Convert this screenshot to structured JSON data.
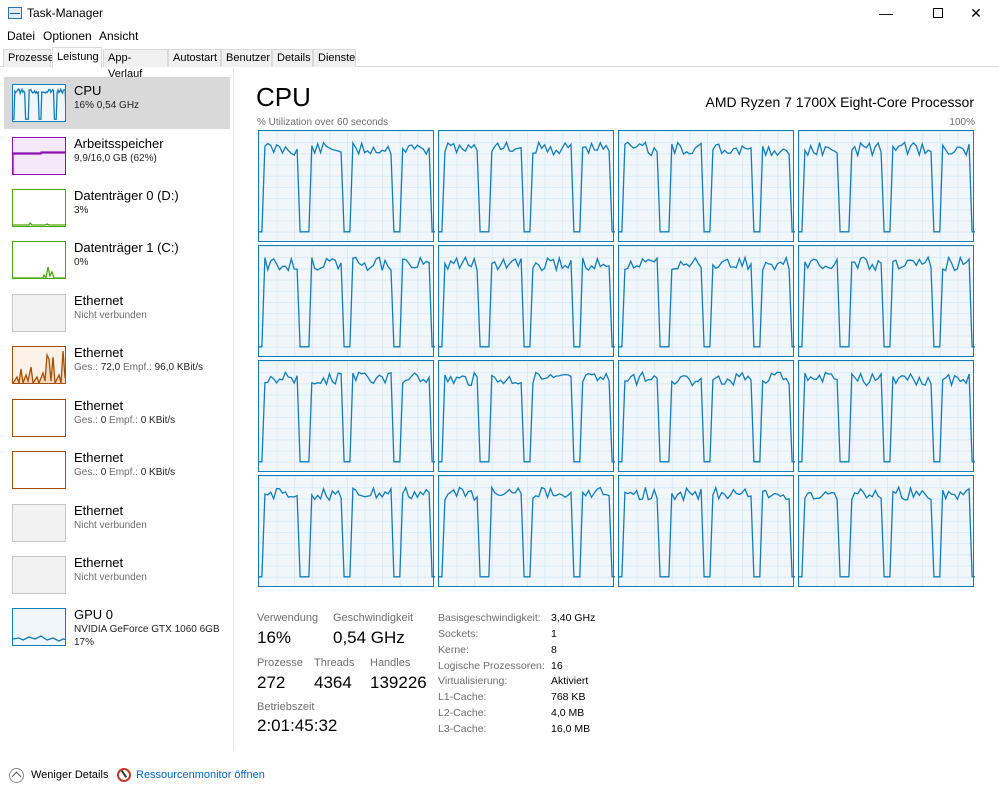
{
  "window": {
    "title": "Task-Manager"
  },
  "menu": [
    "Datei",
    "Optionen",
    "Ansicht"
  ],
  "tabs": [
    "Prozesse",
    "Leistung",
    "App-Verlauf",
    "Autostart",
    "Benutzer",
    "Details",
    "Dienste"
  ],
  "active_tab": "Leistung",
  "sidebar": {
    "items": [
      {
        "title": "CPU",
        "sub": "16% 0,54 GHz",
        "color": "#117dbb",
        "kind": "cpu",
        "selected": true
      },
      {
        "title": "Arbeitsspeicher",
        "sub": "9,9/16,0 GB (62%)",
        "color": "#8b12ae",
        "kind": "memory"
      },
      {
        "title": "Datenträger 0 (D:)",
        "sub": "3%",
        "color": "#4da60c",
        "kind": "disk0"
      },
      {
        "title": "Datenträger 1 (C:)",
        "sub": "0%",
        "color": "#4da60c",
        "kind": "disk1"
      },
      {
        "title": "Ethernet",
        "sub": "Nicht verbunden",
        "color": "#c8c8c8",
        "kind": "none",
        "gray": true
      },
      {
        "title": "Ethernet",
        "sub_prefix1": "Ges.:",
        "sub_value1": "72,0",
        "sub_prefix2": "Empf.:",
        "sub_value2": "96,0 KBit/s",
        "color": "#a74f01",
        "kind": "net"
      },
      {
        "title": "Ethernet",
        "sub_prefix1": "Ges.:",
        "sub_value1": "0",
        "sub_prefix2": "Empf.:",
        "sub_value2": "0 KBit/s",
        "color": "#a74f01",
        "kind": "flat"
      },
      {
        "title": "Ethernet",
        "sub_prefix1": "Ges.:",
        "sub_value1": "0",
        "sub_prefix2": "Empf.:",
        "sub_value2": "0 KBit/s",
        "color": "#a74f01",
        "kind": "flat"
      },
      {
        "title": "Ethernet",
        "sub": "Nicht verbunden",
        "color": "#c8c8c8",
        "kind": "none",
        "gray": true
      },
      {
        "title": "Ethernet",
        "sub": "Nicht verbunden",
        "color": "#c8c8c8",
        "kind": "none",
        "gray": true
      },
      {
        "title": "GPU 0",
        "sub": "NVIDIA GeForce GTX 1060 6GB",
        "sub2": "17%",
        "color": "#117dbb",
        "kind": "gpu"
      }
    ]
  },
  "main": {
    "title": "CPU",
    "processor": "AMD Ryzen 7 1700X Eight-Core Processor",
    "util_label": "% Utilization over 60 seconds",
    "util_max": "100%",
    "graph_color": "#117dbb",
    "logical_graphs": 16
  },
  "stats": {
    "usage_label": "Verwendung",
    "usage": "16%",
    "speed_label": "Geschwindigkeit",
    "speed": "0,54 GHz",
    "processes_label": "Prozesse",
    "processes": "272",
    "threads_label": "Threads",
    "threads": "4364",
    "handles_label": "Handles",
    "handles": "139226",
    "uptime_label": "Betriebszeit",
    "uptime": "2:01:45:32"
  },
  "info": [
    {
      "label": "Basisgeschwindigkeit:",
      "value": "3,40 GHz"
    },
    {
      "label": "Sockets:",
      "value": "1"
    },
    {
      "label": "Kerne:",
      "value": "8"
    },
    {
      "label": "Logische Prozessoren:",
      "value": "16"
    },
    {
      "label": "Virtualisierung:",
      "value": "Aktiviert"
    },
    {
      "label": "L1-Cache:",
      "value": "768 KB"
    },
    {
      "label": "L2-Cache:",
      "value": "4,0 MB"
    },
    {
      "label": "L3-Cache:",
      "value": "16,0 MB"
    }
  ],
  "footer": {
    "less_details": "Weniger Details",
    "resource_monitor": "Ressourcenmonitor öffnen"
  }
}
